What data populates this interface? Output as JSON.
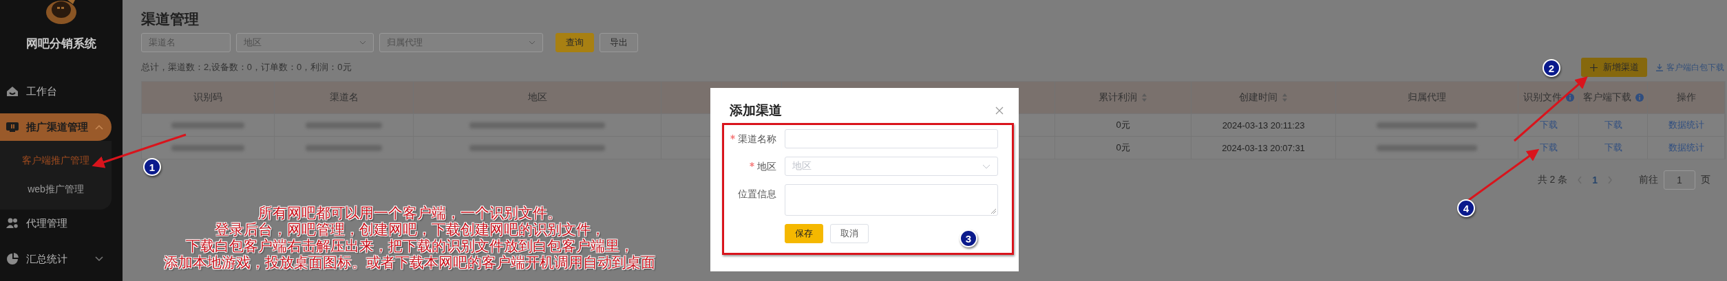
{
  "sidebar": {
    "brand": "网吧分销系统",
    "menu": [
      {
        "label": "工作台",
        "selected": false
      },
      {
        "label": "推广渠道管理",
        "selected": true,
        "expanded": true,
        "children": [
          {
            "label": "客户端推广管理",
            "selected": true
          },
          {
            "label": "web推广管理",
            "selected": false
          }
        ]
      },
      {
        "label": "代理管理",
        "selected": false
      },
      {
        "label": "汇总统计",
        "selected": false,
        "expanded": false
      }
    ]
  },
  "page": {
    "title": "渠道管理",
    "filters": [
      {
        "kind": "input",
        "placeholder": "渠道名"
      },
      {
        "kind": "select",
        "placeholder": "地区"
      },
      {
        "kind": "select",
        "placeholder": "归属代理"
      }
    ],
    "buttons": [
      {
        "label": "查询",
        "primary": true
      },
      {
        "label": "导出",
        "primary": false
      }
    ],
    "summary": "总计，渠道数：2,设备数：0，订单数：0，利润：0元",
    "add_button": "新增渠道",
    "download_link": "客户端白包下载"
  },
  "table": {
    "columns": [
      {
        "label": "识别码",
        "kind": "blurred",
        "sortable": false,
        "info": false
      },
      {
        "label": "渠道名",
        "kind": "blurred",
        "sortable": false,
        "info": false
      },
      {
        "label": "地区",
        "kind": "blurred",
        "sortable": false,
        "info": false
      },
      {
        "kind": "empty"
      },
      {
        "kind": "empty"
      },
      {
        "label": "累计利润",
        "kind": "text",
        "sortable": true,
        "info": false
      },
      {
        "label": "创建时间",
        "kind": "text",
        "sortable": true,
        "info": false
      },
      {
        "label": "归属代理",
        "kind": "blurred",
        "sortable": false,
        "info": false
      },
      {
        "label": "识别文件",
        "kind": "link",
        "sortable": false,
        "info": true
      },
      {
        "label": "客户端下载",
        "kind": "link",
        "sortable": false,
        "info": true
      },
      {
        "label": "操作",
        "kind": "link",
        "sortable": false,
        "info": false
      }
    ],
    "rows": [
      {
        "values": [
          "0元",
          "2024-03-13 20:11:23",
          "下载",
          "下载",
          "数据统计"
        ]
      },
      {
        "values": [
          "0元",
          "2024-03-13 20:07:31",
          "下载",
          "下载",
          "数据统计"
        ]
      }
    ]
  },
  "pagination": {
    "total": "共 2 条",
    "prev_disabled": true,
    "pages": [
      {
        "label": "1",
        "selected": true
      }
    ],
    "next_disabled": true,
    "goto_label": "前往",
    "goto_value": "1",
    "page_label": "页"
  },
  "dialog": {
    "title": "添加渠道",
    "fields": [
      {
        "kind": "input",
        "label": "渠道名称",
        "required": true
      },
      {
        "kind": "select",
        "label": "地区",
        "required": true,
        "placeholder": "地区"
      },
      {
        "kind": "textarea",
        "label": "位置信息",
        "required": false
      }
    ],
    "buttons": [
      {
        "label": "保存",
        "primary": true
      },
      {
        "label": "取消",
        "primary": false
      }
    ]
  },
  "annotations": {
    "markers": [
      {
        "number": "1"
      },
      {
        "number": "2"
      },
      {
        "number": "3"
      },
      {
        "number": "4"
      }
    ],
    "note_lines": [
      "所有网吧都可以用一个客户端，一个识别文件。",
      "登录后台，网吧管理，创建网吧，下载创建网吧的识别文件，",
      "下载白包客户端右击解压出来，把下载的识别文件放到白包客户端里，",
      "添加本地游戏，投放桌面图标。或者下载本网吧的客户端开机调用自动到桌面"
    ]
  }
}
